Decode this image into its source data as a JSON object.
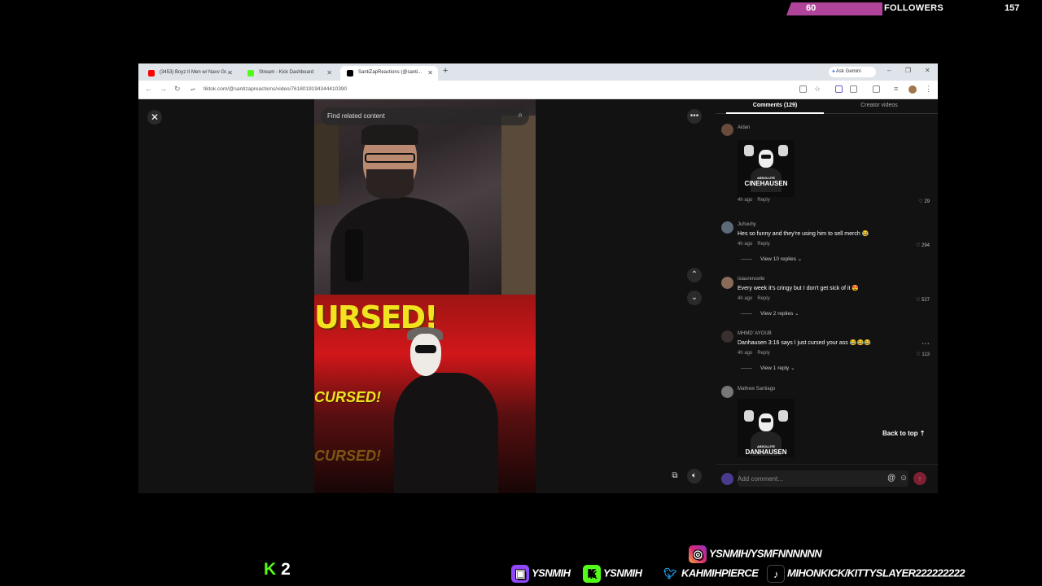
{
  "overlay": {
    "followers_count": "60",
    "followers_label": "FOLLOWERS",
    "followers_goal": "157",
    "kick_count": "2",
    "socials": {
      "instagram": "YSNMIH/YSMFNNNNNN",
      "twitch": "YSNMIH",
      "kick": "YSNMIH",
      "twitter": "KAHMIHPIERCE",
      "tiktok": "MIHONKICK/KITTYSLAYER222222222"
    }
  },
  "browser": {
    "tabs": [
      {
        "label": "(3453) Boyz II Men w/ Navv Gr...",
        "color": "#ff0000"
      },
      {
        "label": "Stream - Kick Dashboard",
        "color": "#53fc18"
      },
      {
        "label": "SantiZapReactions (@santi...",
        "color": "#000000"
      }
    ],
    "ask_gemini": "Ask Gemini",
    "url": "tiktok.com/@santizapreactions/video/7618019194344410390"
  },
  "video": {
    "search_placeholder": "Find related content",
    "overlay_text_big": "URSED!",
    "overlay_text_small": "CURSED!"
  },
  "comments_panel": {
    "tab_comments": "Comments (129)",
    "tab_creator": "Creator videos",
    "comments": [
      {
        "user": "Aidan",
        "image_line1": "ABSOLUTE",
        "image_line2": "CINEHAUSEN",
        "time": "4h ago",
        "reply": "Reply",
        "likes": "29"
      },
      {
        "user": "Juhuuhy",
        "text": "Hes so funny and they're using him to sell merch 😂",
        "time": "4h ago",
        "reply": "Reply",
        "likes": "294",
        "replies": "View 10 replies"
      },
      {
        "user": "isiaurencelle",
        "text": "Every week it's cringy but I don't get sick of it 😍",
        "time": "4h ago",
        "reply": "Reply",
        "likes": "527",
        "replies": "View 2 replies"
      },
      {
        "user": "MHMD' AYOUB",
        "text": "Danhausen 3:16 says I just cursed your ass 😂😂😂",
        "time": "4h ago",
        "reply": "Reply",
        "likes": "113",
        "replies": "View 1 reply"
      },
      {
        "user": "Mathew Santiago",
        "image_line1": "ABSOLUTE",
        "image_line2": "DANHAUSEN"
      }
    ],
    "back_to_top": "Back to top",
    "add_comment_placeholder": "Add comment..."
  }
}
